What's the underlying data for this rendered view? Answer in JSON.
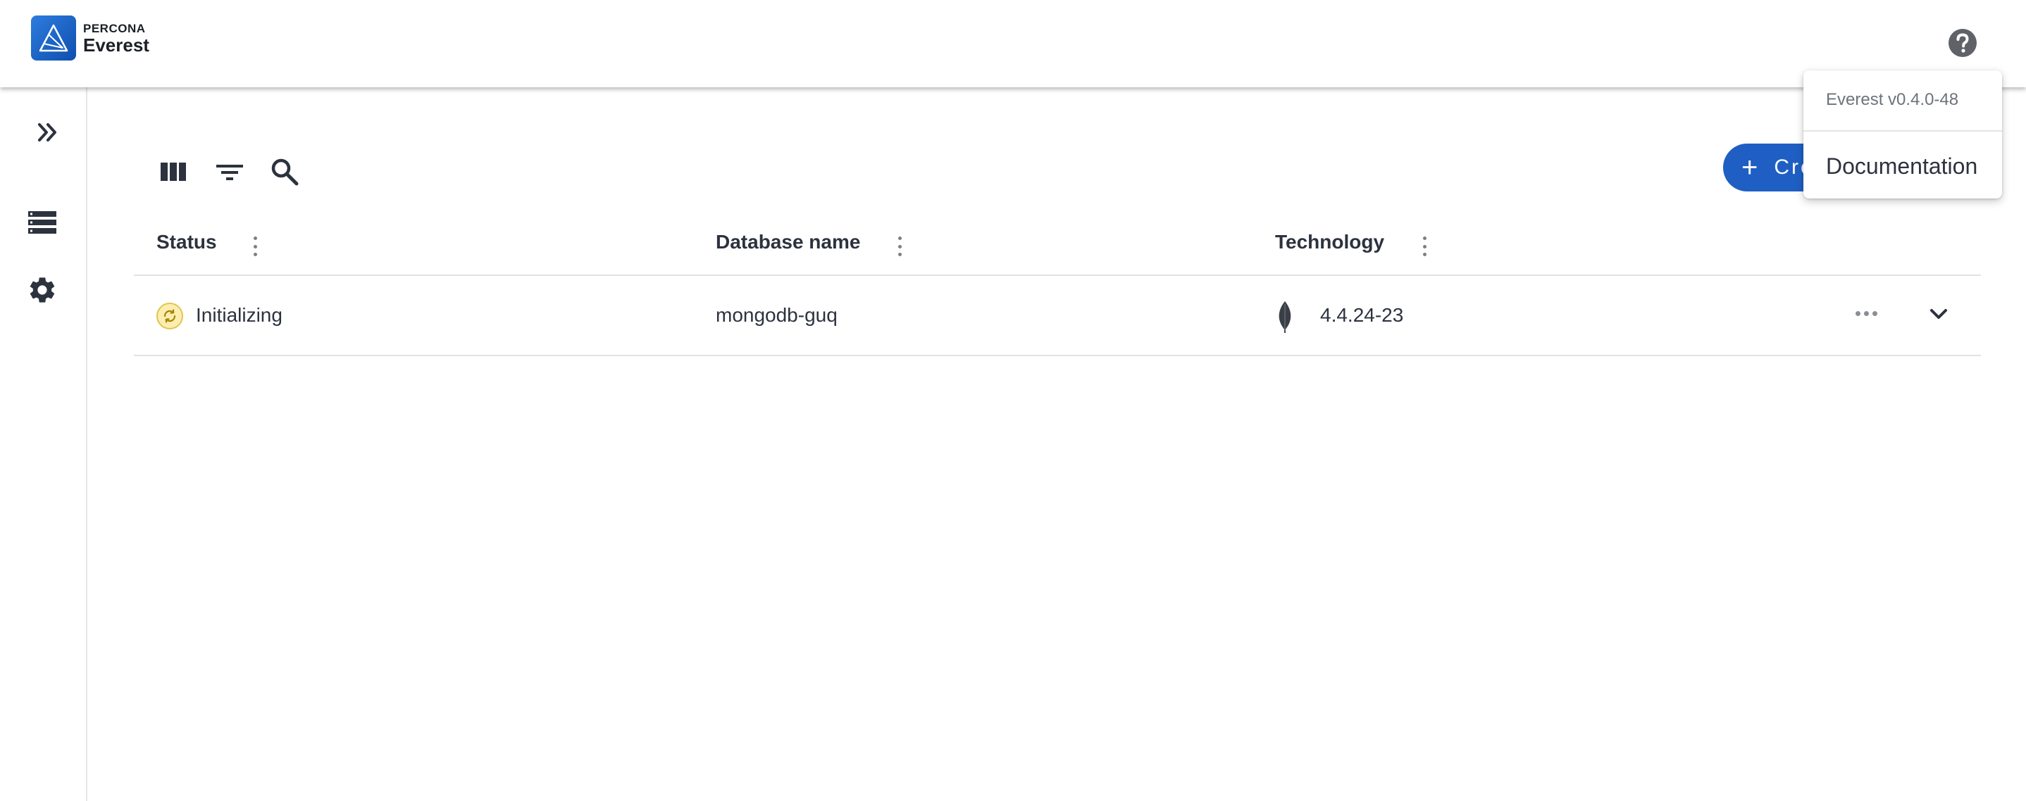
{
  "header": {
    "logo_brand": "PERCONA",
    "logo_product": "Everest",
    "help_icon": "help-circle-icon"
  },
  "sidebar": {
    "items": [
      {
        "name": "expand",
        "icon": "chevron-double-right-icon"
      },
      {
        "name": "databases",
        "icon": "database-list-icon"
      },
      {
        "name": "settings",
        "icon": "gear-icon"
      }
    ]
  },
  "toolbar": {
    "icons": [
      "columns-icon",
      "filter-icon",
      "search-icon"
    ],
    "create_label": "Cre"
  },
  "table": {
    "columns": [
      {
        "label": "Status"
      },
      {
        "label": "Database name"
      },
      {
        "label": "Technology"
      }
    ],
    "rows": [
      {
        "status": "Initializing",
        "status_color": "#e3c44e",
        "database_name": "mongodb-guq",
        "technology_icon": "mongodb-leaf-icon",
        "technology_version": "4.4.24-23"
      }
    ]
  },
  "help_menu": {
    "version": "Everest v0.4.0-48",
    "documentation_label": "Documentation"
  },
  "colors": {
    "primary": "#1f5fc4",
    "logo": "#1a63cf"
  }
}
